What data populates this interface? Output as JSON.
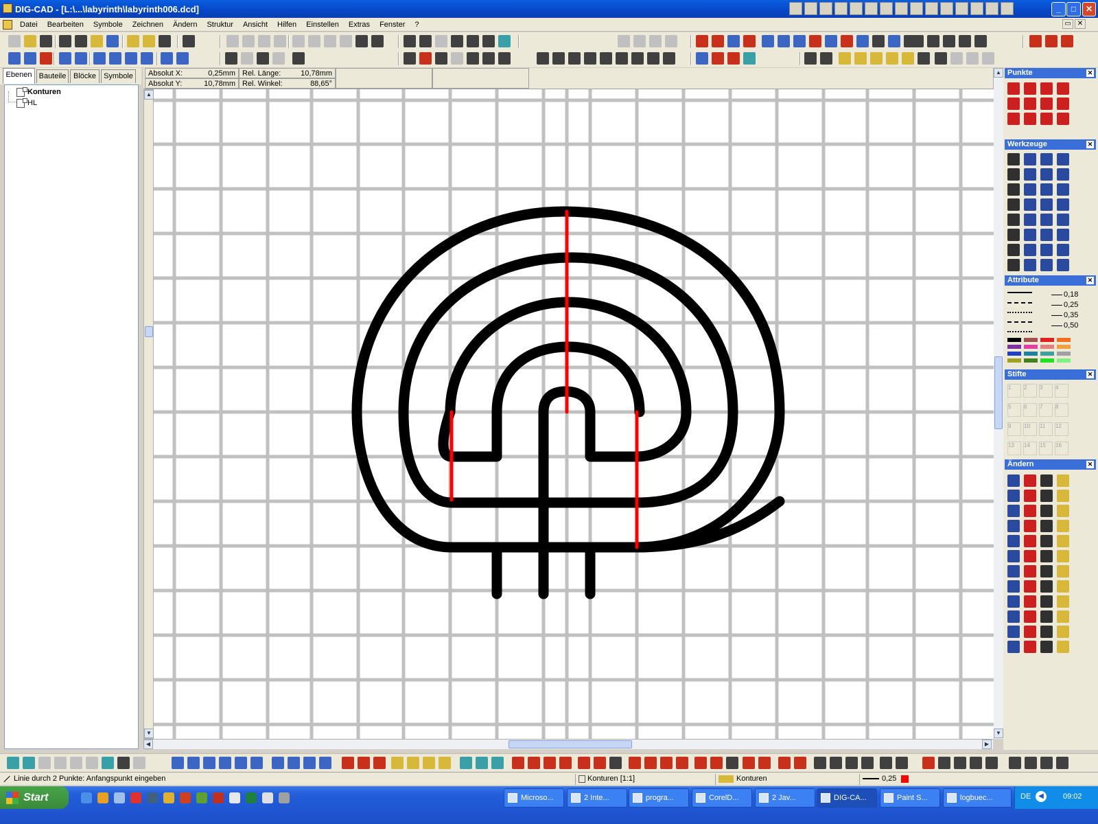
{
  "window": {
    "title": "DIG-CAD - [L:\\...\\labyrinth\\labyrinth006.dcd]"
  },
  "menu": [
    "Datei",
    "Bearbeiten",
    "Symbole",
    "Zeichnen",
    "Ändern",
    "Struktur",
    "Ansicht",
    "Hilfen",
    "Einstellen",
    "Extras",
    "Fenster",
    "?"
  ],
  "left_tabs": [
    "Ebenen",
    "Bauteile",
    "Blöcke",
    "Symbole"
  ],
  "layers": [
    "Konturen",
    "HL"
  ],
  "coords": {
    "absx_label": "Absolut X:",
    "absx": "0,25mm",
    "absy_label": "Absolut Y:",
    "absy": "10,78mm",
    "rell_label": "Rel. Länge:",
    "rell": "10,78mm",
    "relw_label": "Rel. Winkel:",
    "relw": "88,65°"
  },
  "panels": {
    "punkte": "Punkte",
    "werkzeuge": "Werkzeuge",
    "attribute": "Attribute",
    "stifte": "Stifte",
    "aendern": "Ändern"
  },
  "line_widths": [
    "0,18",
    "0,25",
    "0,35",
    "0,50"
  ],
  "pen_labels": [
    "1",
    "2",
    "3",
    "4",
    "5",
    "6",
    "7",
    "8",
    "9",
    "10",
    "11",
    "12",
    "13",
    "14",
    "15",
    "16"
  ],
  "colors": {
    "line": "#000000",
    "highlight": "#ff0000",
    "grid": "#c0c0c0"
  },
  "status": {
    "hint": "Linie durch 2 Punkte: Anfangspunkt eingeben",
    "layer": "Konturen [1:1]",
    "layer2": "Konturen",
    "width": "0,25"
  },
  "taskbar": {
    "start": "Start",
    "tasks": [
      "Microso...",
      "2 Inte...",
      "progra...",
      "CorelD...",
      "2 Jav...",
      "DIG-CA...",
      "Paint S...",
      "logbuec..."
    ],
    "lang": "DE",
    "time": "09:02"
  }
}
